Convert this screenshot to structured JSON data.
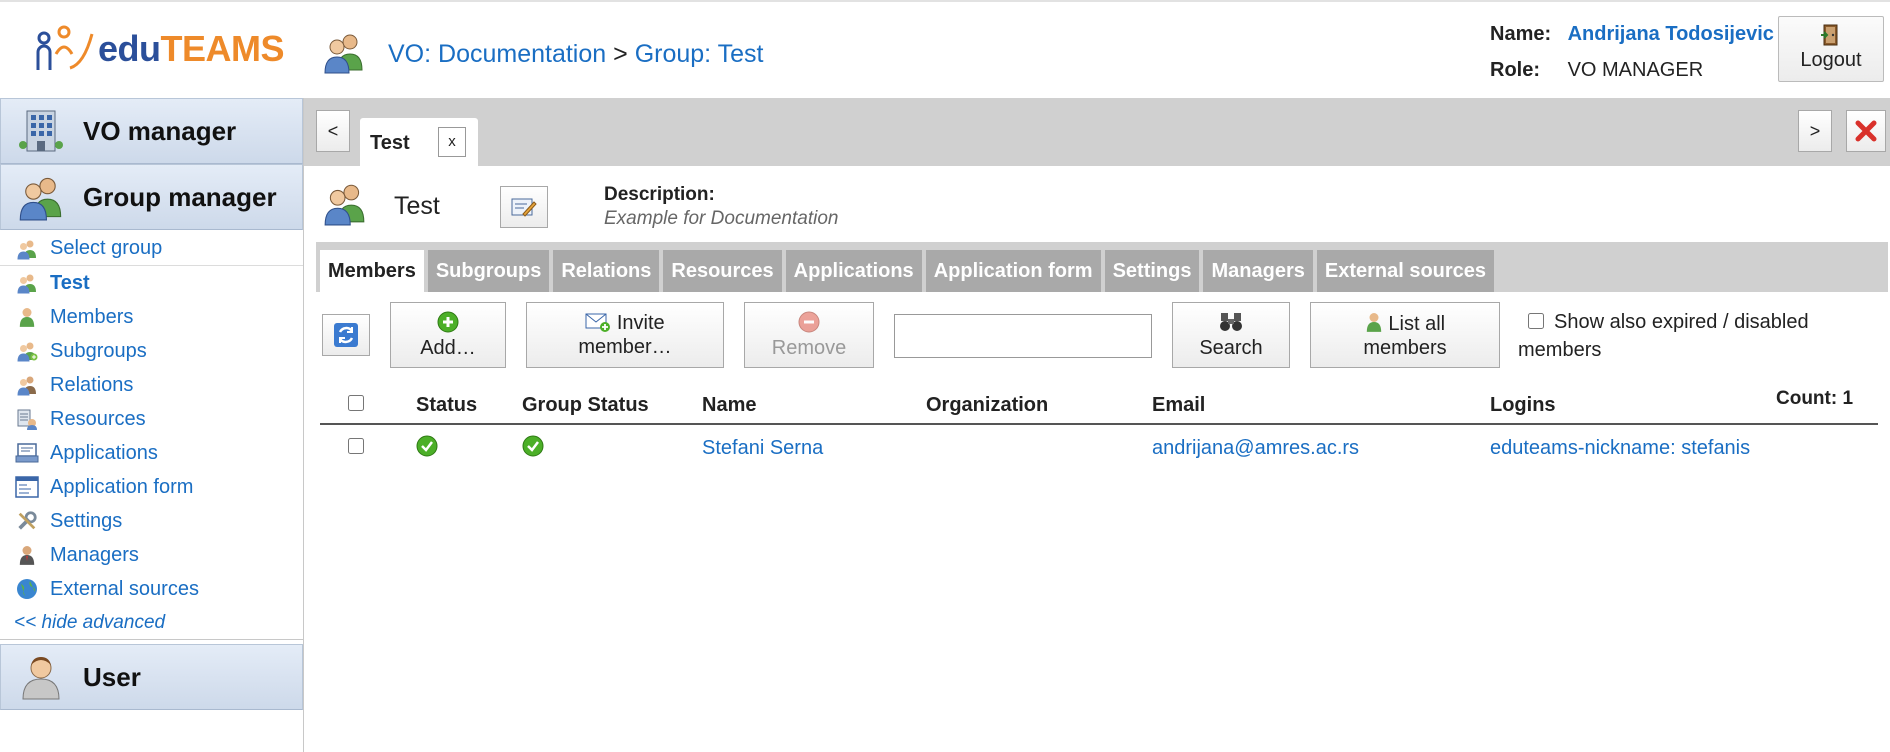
{
  "brand": {
    "edu": "edu",
    "teams": "TEAMS"
  },
  "breadcrumb": {
    "vo": "VO: Documentation",
    "separator": ">",
    "group": "Group: Test"
  },
  "user": {
    "name_label": "Name:",
    "name": "Andrijana Todosijevic",
    "role_label": "Role:",
    "role": "VO MANAGER",
    "logout_label": "Logout"
  },
  "sidebar": {
    "sections": {
      "vo_manager": "VO manager",
      "group_manager": "Group manager",
      "user": "User"
    },
    "items": [
      {
        "label": "Select group",
        "icon": "group-icon"
      },
      {
        "label": "Test",
        "icon": "group-icon"
      },
      {
        "label": "Members",
        "icon": "member-icon"
      },
      {
        "label": "Subgroups",
        "icon": "subgroups-icon"
      },
      {
        "label": "Relations",
        "icon": "relations-icon"
      },
      {
        "label": "Resources",
        "icon": "resources-icon"
      },
      {
        "label": "Applications",
        "icon": "applications-icon"
      },
      {
        "label": "Application form",
        "icon": "form-icon"
      },
      {
        "label": "Settings",
        "icon": "settings-icon"
      },
      {
        "label": "Managers",
        "icon": "manager-icon"
      },
      {
        "label": "External sources",
        "icon": "globe-icon"
      }
    ],
    "hide_advanced": "<< hide advanced"
  },
  "tabbar": {
    "prev": "<",
    "next": ">",
    "open_tab": "Test",
    "close_tab": "x"
  },
  "group": {
    "name": "Test",
    "description_label": "Description:",
    "description": "Example for Documentation"
  },
  "subtabs": [
    "Members",
    "Subgroups",
    "Relations",
    "Resources",
    "Applications",
    "Application form",
    "Settings",
    "Managers",
    "External sources"
  ],
  "toolbar": {
    "add": "Add…",
    "invite_line1": "Invite",
    "invite_line2": "member…",
    "remove": "Remove",
    "search": "Search",
    "search_value": "",
    "list_all_line1": "List all",
    "list_all_line2": "members",
    "show_expired": "Show also expired / disabled members"
  },
  "table": {
    "count": "Count: 1",
    "columns": [
      "Status",
      "Group Status",
      "Name",
      "Organization",
      "Email",
      "Logins"
    ],
    "rows": [
      {
        "status": "ok",
        "group_status": "ok",
        "name": "Stefani Serna",
        "organization": "",
        "email": "andrijana@amres.ac.rs",
        "logins": "eduteams-nickname: stefanis"
      }
    ]
  },
  "colors": {
    "link": "#1a6ec3",
    "brand_blue": "#2b4f9a",
    "brand_orange": "#ee8a2a",
    "tab_gray": "#a9a9a9",
    "status_green": "#4caf28",
    "close_red": "#d9312b"
  }
}
